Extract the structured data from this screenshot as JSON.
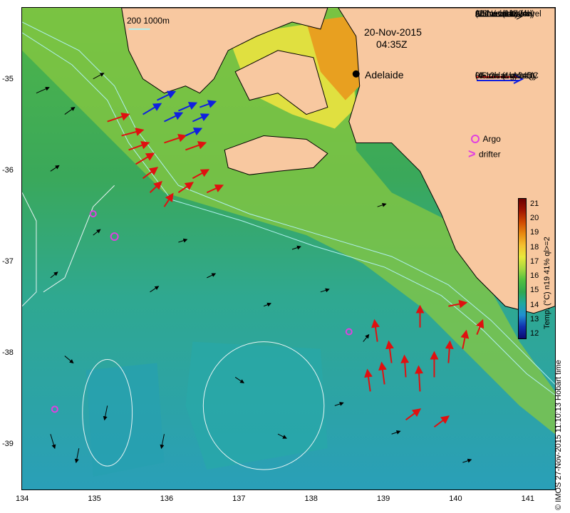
{
  "header": {
    "date": "20-Nov-2015",
    "time": "04:35Z",
    "scale_label": "200  1000m"
  },
  "city": {
    "name": "Adelaide"
  },
  "legend": {
    "altimetry_lines": [
      "Altimetric sealevel",
      "(0.1m contours)",
      "and velocity for",
      "20-Nov 04Z",
      "0.5m/s (1kt 24h)"
    ],
    "hf_lines": [
      "HF radar velocity",
      "(4-12h avg)noQC",
      "0.5m/s (1kt 24h)"
    ],
    "argo_label": "Argo",
    "drifter_label": "drifter",
    "colors": {
      "argo": "#e040e0",
      "hf_red": "#e01010",
      "hf_blue": "#1020e0"
    }
  },
  "colorbar": {
    "title": "Temp. (°C) n19 41% ql>=2",
    "ticks": [
      "21",
      "20",
      "19",
      "18",
      "17",
      "16",
      "15",
      "14",
      "13",
      "12"
    ],
    "palette": [
      "#6b0000",
      "#a01500",
      "#d04a00",
      "#e88a10",
      "#f5c030",
      "#e8e83a",
      "#a8d840",
      "#50c040",
      "#30a850",
      "#20a8a0",
      "#2090d0",
      "#1030b0",
      "#0a0a70"
    ]
  },
  "axes": {
    "x_ticks": [
      "134",
      "135",
      "136",
      "137",
      "138",
      "139",
      "140",
      "141"
    ],
    "y_ticks": [
      "-35",
      "-36",
      "-37",
      "-38",
      "-39"
    ]
  },
  "credit": "© IMOS 27-Nov-2015 11:10:13 Hobart time"
}
